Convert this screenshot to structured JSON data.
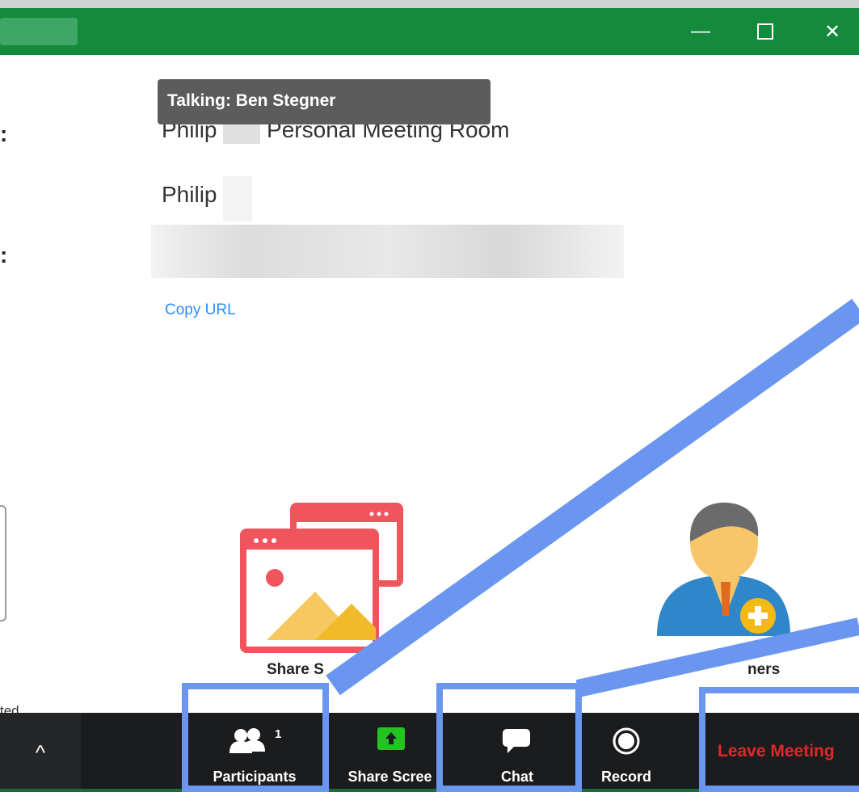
{
  "window": {
    "minimize_glyph": "—",
    "close_glyph": "✕"
  },
  "tooltip": "Talking: Ben Stegner",
  "info": {
    "topic_prefix": "Philip",
    "topic_suffix": "Personal Meeting Room",
    "host": "Philip",
    "copy_url": "Copy URL"
  },
  "tiles": {
    "share_screen_label": "Share S",
    "invite_label": "ners"
  },
  "left_note": "ted",
  "toolbar": {
    "caret": "^",
    "participants_label": "Participants",
    "participants_count": "1",
    "share_label": "Share Scree",
    "chat_label": "Chat",
    "record_label": "Record",
    "leave_label": "Leave Meeting"
  },
  "colors": {
    "titlebar": "#138a3c",
    "annotation": "#6b96f0",
    "leave": "#e02828",
    "share_green": "#23c420",
    "share_red": "#f0545c"
  },
  "icons": {
    "participants": "people-icon",
    "share": "share-screen-icon",
    "chat": "chat-bubble-icon",
    "record": "record-icon"
  }
}
